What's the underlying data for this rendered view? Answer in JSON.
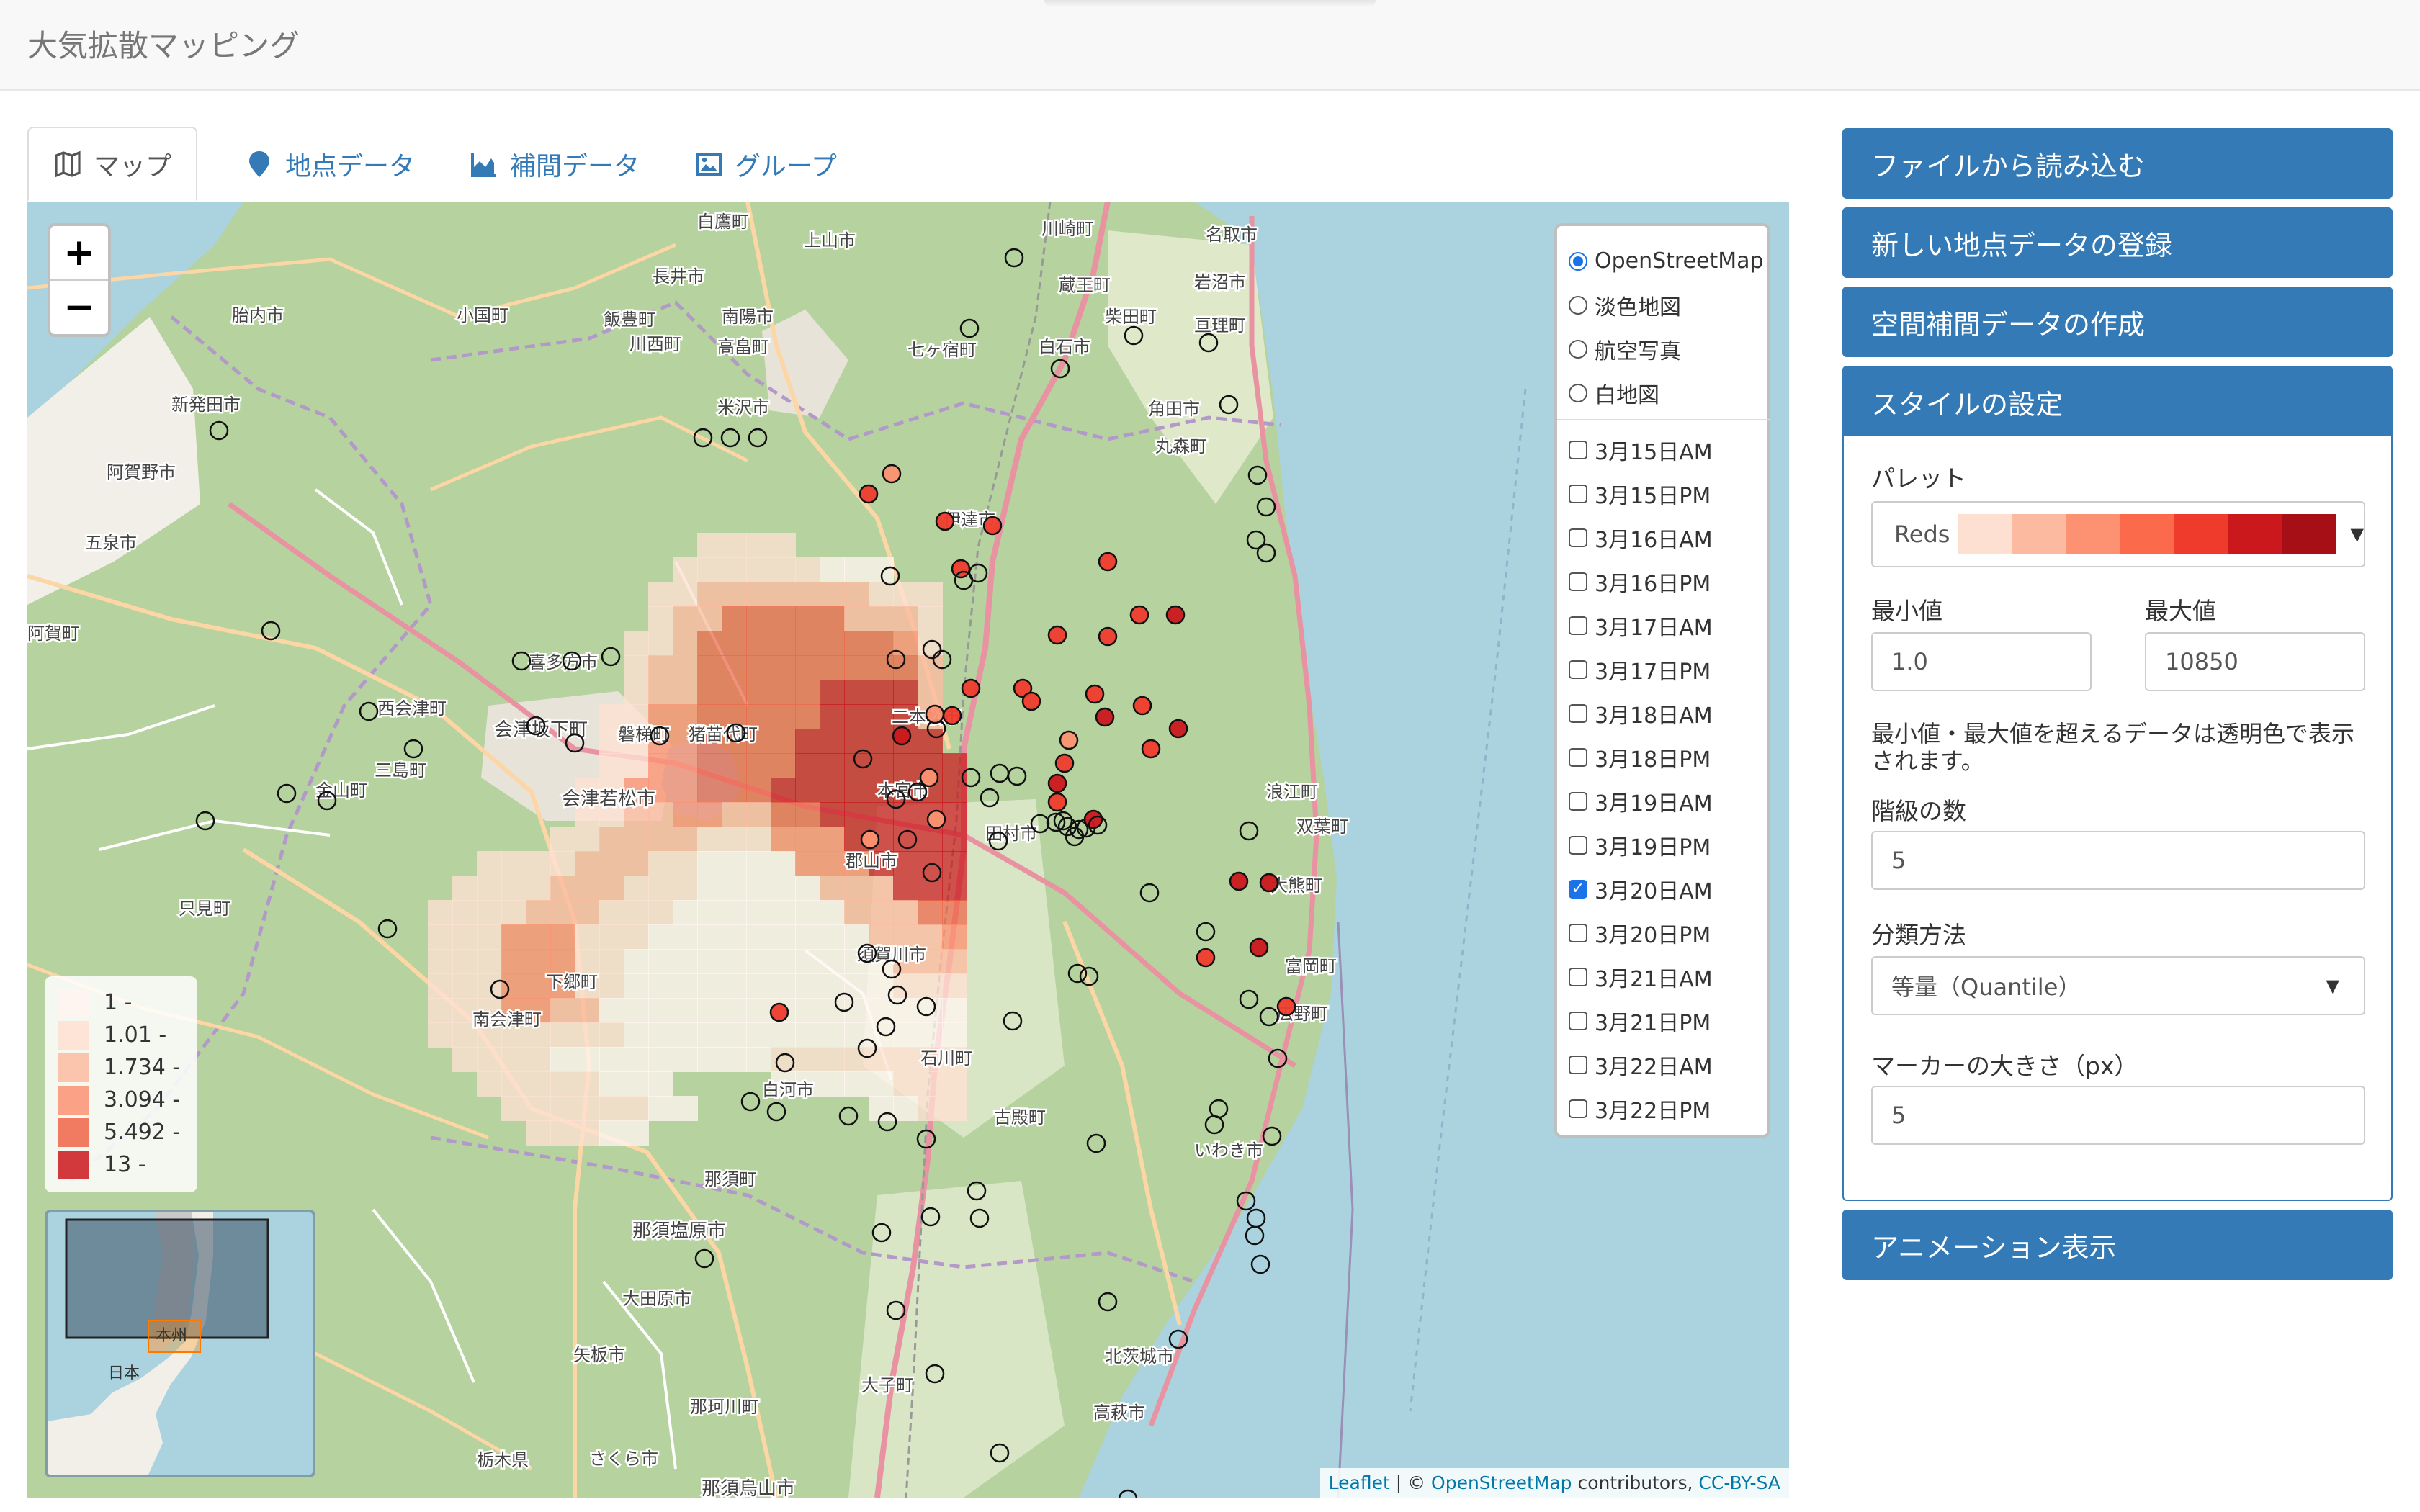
{
  "app": {
    "title": "大気拡散マッピング"
  },
  "tabs": [
    {
      "label": "マップ",
      "icon": "map-icon",
      "active": true
    },
    {
      "label": "地点データ",
      "icon": "map-marker-icon",
      "active": false
    },
    {
      "label": "補間データ",
      "icon": "area-chart-icon",
      "active": false
    },
    {
      "label": "グループ",
      "icon": "image-icon",
      "active": false
    }
  ],
  "map": {
    "zoom_in": "+",
    "zoom_out": "−",
    "base_layers": [
      {
        "label": "OpenStreetMap",
        "selected": true
      },
      {
        "label": "淡色地図",
        "selected": false
      },
      {
        "label": "航空写真",
        "selected": false
      },
      {
        "label": "白地図",
        "selected": false
      }
    ],
    "overlays": [
      {
        "label": "3月15日AM",
        "checked": false
      },
      {
        "label": "3月15日PM",
        "checked": false
      },
      {
        "label": "3月16日AM",
        "checked": false
      },
      {
        "label": "3月16日PM",
        "checked": false
      },
      {
        "label": "3月17日AM",
        "checked": false
      },
      {
        "label": "3月17日PM",
        "checked": false
      },
      {
        "label": "3月18日AM",
        "checked": false
      },
      {
        "label": "3月18日PM",
        "checked": false
      },
      {
        "label": "3月19日AM",
        "checked": false
      },
      {
        "label": "3月19日PM",
        "checked": false
      },
      {
        "label": "3月20日AM",
        "checked": true
      },
      {
        "label": "3月20日PM",
        "checked": false
      },
      {
        "label": "3月21日AM",
        "checked": false
      },
      {
        "label": "3月21日PM",
        "checked": false
      },
      {
        "label": "3月22日AM",
        "checked": false
      },
      {
        "label": "3月22日PM",
        "checked": false
      }
    ],
    "legend": [
      {
        "label": "1 -",
        "color": "#fff5f0"
      },
      {
        "label": "1.01 -",
        "color": "#fee0d2"
      },
      {
        "label": "1.734 -",
        "color": "#fcbba1"
      },
      {
        "label": "3.094 -",
        "color": "#fc9272"
      },
      {
        "label": "5.492 -",
        "color": "#ef6548"
      },
      {
        "label": "13 -",
        "color": "#cb181d"
      }
    ],
    "minimap_labels": {
      "region": "本州",
      "country": "日本"
    },
    "place_labels": [
      "白鷹町",
      "上山市",
      "川崎町",
      "名取市",
      "長井市",
      "蔵王町",
      "岩沼市",
      "胎内市",
      "小国町",
      "飯豊町",
      "南陽市",
      "柴田町",
      "亘理町",
      "川西町",
      "高畠町",
      "七ヶ宿町",
      "白石市",
      "新発田市",
      "米沢市",
      "角田市",
      "阿賀野市",
      "五泉市",
      "丸森町",
      "伊達市",
      "阿賀町",
      "喜多方市",
      "西会津町",
      "会津坂下町",
      "磐梯町",
      "猪苗代町",
      "二本松市",
      "三島町",
      "金山町",
      "会津若松市",
      "本宮市",
      "田村市",
      "浪江町",
      "双葉町",
      "只見町",
      "郡山市",
      "大熊町",
      "下郷町",
      "須賀川市",
      "富岡町",
      "南会津町",
      "石川町",
      "広野町",
      "白河市",
      "古殿町",
      "那須町",
      "いわき市",
      "那須塩原市",
      "大田原市",
      "矢板市",
      "北茨城市",
      "大子町",
      "高萩市",
      "那珂川町",
      "栃木県",
      "さくら市",
      "那須烏山市",
      "日本"
    ],
    "attribution": {
      "leaflet": "Leaflet",
      "sep": " | © ",
      "osm": "OpenStreetMap",
      "contrib": " contributors, ",
      "license": "CC-BY-SA"
    }
  },
  "sidebar": {
    "buttons": [
      "ファイルから読み込む",
      "新しい地点データの登録",
      "空間補間データの作成"
    ],
    "style_panel": {
      "title": "スタイルの設定",
      "palette_label": "パレット",
      "palette_value": "Reds",
      "palette_colors": [
        "#fee0d2",
        "#fcbba1",
        "#fc9272",
        "#fb6a4a",
        "#ef3b2c",
        "#cb181d",
        "#a50f15"
      ],
      "min_label": "最小値",
      "min_value": "1.0",
      "max_label": "最大値",
      "max_value": "10850",
      "note": "最小値・最大値を超えるデータは透明色で表示されます。",
      "classes_label": "階級の数",
      "classes_value": "5",
      "method_label": "分類方法",
      "method_value": "等量（Quantile）",
      "marker_label": "マーカーの大きさ（px）",
      "marker_value": "5"
    },
    "animation_button": "アニメーション表示"
  }
}
